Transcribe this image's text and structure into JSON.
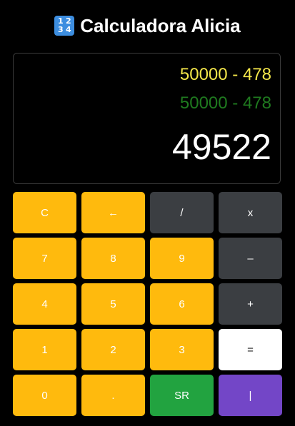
{
  "header": {
    "icon_digits": [
      "1",
      "2",
      "3",
      "4"
    ],
    "title": "Calculadora Alicia"
  },
  "display": {
    "previous_expression": "50000 - 478",
    "current_expression": "50000 - 478",
    "result": "49522"
  },
  "keypad": {
    "clear": "C",
    "backspace": "←",
    "divide": "/",
    "multiply": "x",
    "seven": "7",
    "eight": "8",
    "nine": "9",
    "minus": "–",
    "four": "4",
    "five": "5",
    "six": "6",
    "plus": "+",
    "one": "1",
    "two": "2",
    "three": "3",
    "equals": "=",
    "zero": "0",
    "decimal": ".",
    "sqrt": "SR",
    "pipe": "|"
  },
  "colors": {
    "background": "#000000",
    "key_yellow": "#ffba0d",
    "key_dark": "#3b3e42",
    "key_white": "#ffffff",
    "key_green": "#22a340",
    "key_purple": "#7346c7",
    "previous_text": "#f3e64a",
    "current_text": "#1f7a1f"
  }
}
